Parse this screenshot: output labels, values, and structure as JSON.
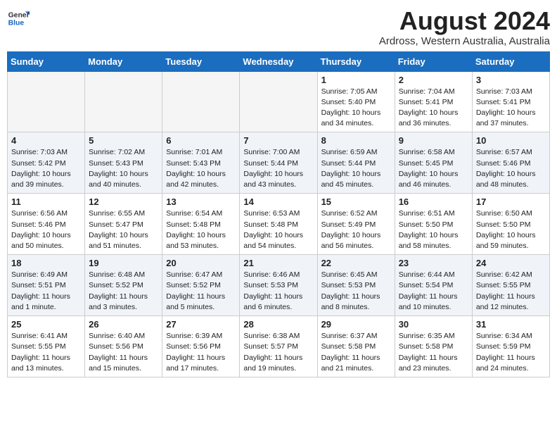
{
  "header": {
    "logo": {
      "general": "General",
      "blue": "Blue"
    },
    "title": "August 2024",
    "subtitle": "Ardross, Western Australia, Australia"
  },
  "weekdays": [
    "Sunday",
    "Monday",
    "Tuesday",
    "Wednesday",
    "Thursday",
    "Friday",
    "Saturday"
  ],
  "weeks": [
    [
      {
        "day": "",
        "info": ""
      },
      {
        "day": "",
        "info": ""
      },
      {
        "day": "",
        "info": ""
      },
      {
        "day": "",
        "info": ""
      },
      {
        "day": "1",
        "info": "Sunrise: 7:05 AM\nSunset: 5:40 PM\nDaylight: 10 hours\nand 34 minutes."
      },
      {
        "day": "2",
        "info": "Sunrise: 7:04 AM\nSunset: 5:41 PM\nDaylight: 10 hours\nand 36 minutes."
      },
      {
        "day": "3",
        "info": "Sunrise: 7:03 AM\nSunset: 5:41 PM\nDaylight: 10 hours\nand 37 minutes."
      }
    ],
    [
      {
        "day": "4",
        "info": "Sunrise: 7:03 AM\nSunset: 5:42 PM\nDaylight: 10 hours\nand 39 minutes."
      },
      {
        "day": "5",
        "info": "Sunrise: 7:02 AM\nSunset: 5:43 PM\nDaylight: 10 hours\nand 40 minutes."
      },
      {
        "day": "6",
        "info": "Sunrise: 7:01 AM\nSunset: 5:43 PM\nDaylight: 10 hours\nand 42 minutes."
      },
      {
        "day": "7",
        "info": "Sunrise: 7:00 AM\nSunset: 5:44 PM\nDaylight: 10 hours\nand 43 minutes."
      },
      {
        "day": "8",
        "info": "Sunrise: 6:59 AM\nSunset: 5:44 PM\nDaylight: 10 hours\nand 45 minutes."
      },
      {
        "day": "9",
        "info": "Sunrise: 6:58 AM\nSunset: 5:45 PM\nDaylight: 10 hours\nand 46 minutes."
      },
      {
        "day": "10",
        "info": "Sunrise: 6:57 AM\nSunset: 5:46 PM\nDaylight: 10 hours\nand 48 minutes."
      }
    ],
    [
      {
        "day": "11",
        "info": "Sunrise: 6:56 AM\nSunset: 5:46 PM\nDaylight: 10 hours\nand 50 minutes."
      },
      {
        "day": "12",
        "info": "Sunrise: 6:55 AM\nSunset: 5:47 PM\nDaylight: 10 hours\nand 51 minutes."
      },
      {
        "day": "13",
        "info": "Sunrise: 6:54 AM\nSunset: 5:48 PM\nDaylight: 10 hours\nand 53 minutes."
      },
      {
        "day": "14",
        "info": "Sunrise: 6:53 AM\nSunset: 5:48 PM\nDaylight: 10 hours\nand 54 minutes."
      },
      {
        "day": "15",
        "info": "Sunrise: 6:52 AM\nSunset: 5:49 PM\nDaylight: 10 hours\nand 56 minutes."
      },
      {
        "day": "16",
        "info": "Sunrise: 6:51 AM\nSunset: 5:50 PM\nDaylight: 10 hours\nand 58 minutes."
      },
      {
        "day": "17",
        "info": "Sunrise: 6:50 AM\nSunset: 5:50 PM\nDaylight: 10 hours\nand 59 minutes."
      }
    ],
    [
      {
        "day": "18",
        "info": "Sunrise: 6:49 AM\nSunset: 5:51 PM\nDaylight: 11 hours\nand 1 minute."
      },
      {
        "day": "19",
        "info": "Sunrise: 6:48 AM\nSunset: 5:52 PM\nDaylight: 11 hours\nand 3 minutes."
      },
      {
        "day": "20",
        "info": "Sunrise: 6:47 AM\nSunset: 5:52 PM\nDaylight: 11 hours\nand 5 minutes."
      },
      {
        "day": "21",
        "info": "Sunrise: 6:46 AM\nSunset: 5:53 PM\nDaylight: 11 hours\nand 6 minutes."
      },
      {
        "day": "22",
        "info": "Sunrise: 6:45 AM\nSunset: 5:53 PM\nDaylight: 11 hours\nand 8 minutes."
      },
      {
        "day": "23",
        "info": "Sunrise: 6:44 AM\nSunset: 5:54 PM\nDaylight: 11 hours\nand 10 minutes."
      },
      {
        "day": "24",
        "info": "Sunrise: 6:42 AM\nSunset: 5:55 PM\nDaylight: 11 hours\nand 12 minutes."
      }
    ],
    [
      {
        "day": "25",
        "info": "Sunrise: 6:41 AM\nSunset: 5:55 PM\nDaylight: 11 hours\nand 13 minutes."
      },
      {
        "day": "26",
        "info": "Sunrise: 6:40 AM\nSunset: 5:56 PM\nDaylight: 11 hours\nand 15 minutes."
      },
      {
        "day": "27",
        "info": "Sunrise: 6:39 AM\nSunset: 5:56 PM\nDaylight: 11 hours\nand 17 minutes."
      },
      {
        "day": "28",
        "info": "Sunrise: 6:38 AM\nSunset: 5:57 PM\nDaylight: 11 hours\nand 19 minutes."
      },
      {
        "day": "29",
        "info": "Sunrise: 6:37 AM\nSunset: 5:58 PM\nDaylight: 11 hours\nand 21 minutes."
      },
      {
        "day": "30",
        "info": "Sunrise: 6:35 AM\nSunset: 5:58 PM\nDaylight: 11 hours\nand 23 minutes."
      },
      {
        "day": "31",
        "info": "Sunrise: 6:34 AM\nSunset: 5:59 PM\nDaylight: 11 hours\nand 24 minutes."
      }
    ]
  ]
}
